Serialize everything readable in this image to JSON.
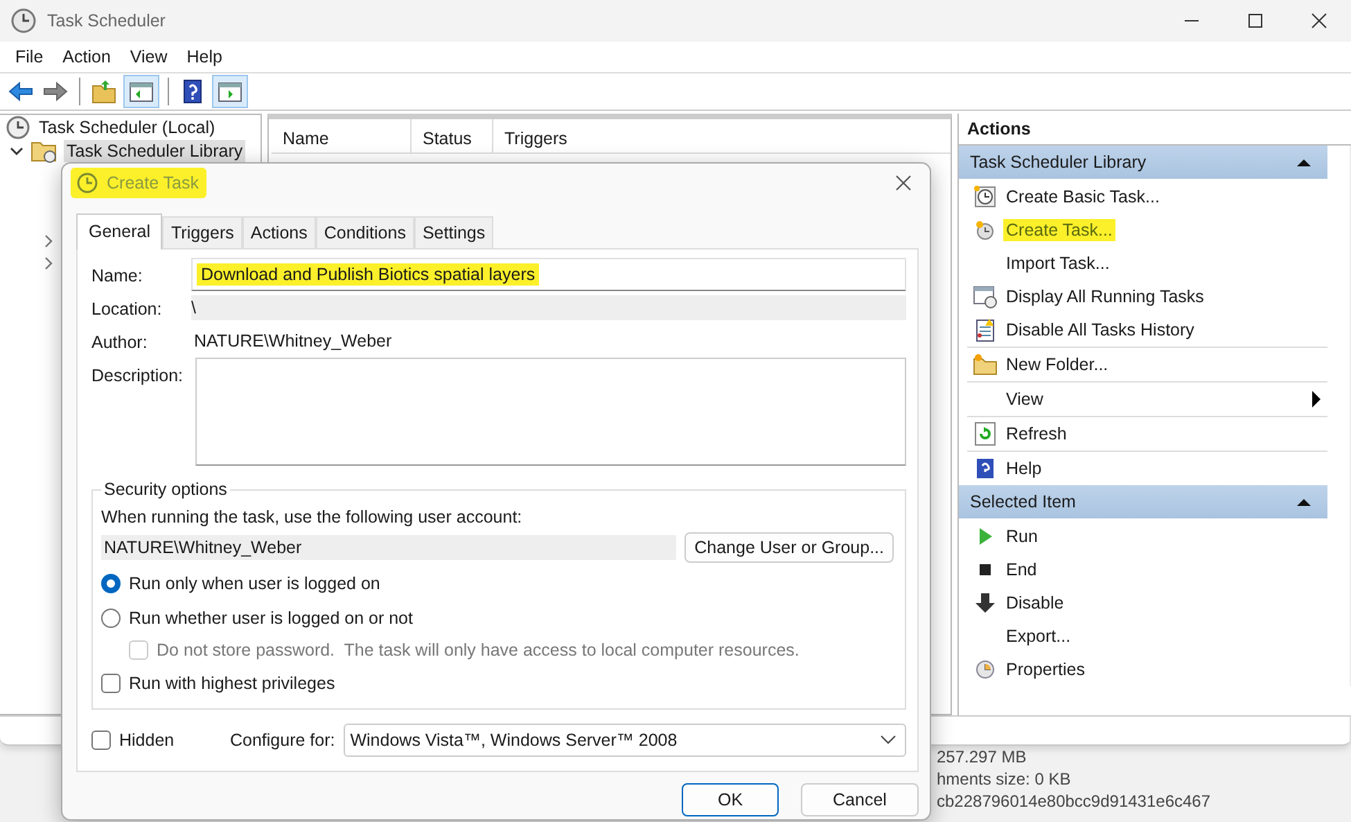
{
  "window": {
    "title": "Task Scheduler"
  },
  "menu": [
    "File",
    "Action",
    "View",
    "Help"
  ],
  "tree": [
    {
      "label": "Task Scheduler (Local)",
      "selected": false,
      "children": [
        {
          "label": "Task Scheduler Library",
          "selected": true,
          "expanded": true
        }
      ]
    }
  ],
  "table": {
    "columns": [
      "Name",
      "Status",
      "Triggers"
    ]
  },
  "actions": {
    "title": "Actions",
    "sections": [
      {
        "title": "Task Scheduler Library",
        "expanded": true,
        "items": [
          {
            "label": "Create Basic Task...",
            "kind": "basic",
            "highlighted": false,
            "divider": false
          },
          {
            "label": "Create Task...",
            "kind": "task",
            "highlighted": true,
            "divider": false
          },
          {
            "label": "Import Task...",
            "kind": "plain",
            "highlighted": false,
            "divider": false
          },
          {
            "label": "Display All Running Tasks",
            "kind": "running",
            "highlighted": false,
            "divider": false
          },
          {
            "label": "Disable All Tasks History",
            "kind": "history",
            "highlighted": false,
            "divider": false
          },
          {
            "label": "New Folder...",
            "kind": "folder",
            "highlighted": false,
            "divider": true
          },
          {
            "label": "View",
            "kind": "submenu",
            "highlighted": false,
            "divider": true
          },
          {
            "label": "Refresh",
            "kind": "refresh",
            "highlighted": false,
            "divider": true
          },
          {
            "label": "Help",
            "kind": "help",
            "highlighted": false,
            "divider": true
          }
        ]
      },
      {
        "title": "Selected Item",
        "expanded": true,
        "items": [
          {
            "label": "Run",
            "kind": "run",
            "highlighted": false,
            "divider": false
          },
          {
            "label": "End",
            "kind": "end",
            "highlighted": false,
            "divider": false
          },
          {
            "label": "Disable",
            "kind": "disable",
            "highlighted": false,
            "divider": false
          },
          {
            "label": "Export...",
            "kind": "plain",
            "highlighted": false,
            "divider": false
          },
          {
            "label": "Properties",
            "kind": "properties",
            "highlighted": false,
            "divider": false
          }
        ]
      }
    ]
  },
  "background_window": {
    "lines": [
      "257.297 MB",
      "hments size: 0 KB",
      "cb228796014e80bcc9d91431e6c467"
    ]
  },
  "dialog": {
    "title": "Create Task",
    "title_highlighted": true,
    "tabs": [
      {
        "label": "General",
        "selected": true
      },
      {
        "label": "Triggers",
        "selected": false
      },
      {
        "label": "Actions",
        "selected": false
      },
      {
        "label": "Conditions",
        "selected": false
      },
      {
        "label": "Settings",
        "selected": false
      }
    ],
    "name_label": "Name:",
    "name_value": "Download and Publish Biotics spatial layers",
    "name_highlighted": true,
    "location_label": "Location:",
    "location_value": "\\",
    "author_label": "Author:",
    "author_value": "NATURE\\Whitney_Weber",
    "description_label": "Description:",
    "security": {
      "title": "Security options",
      "prompt": "When running the task, use the following user account:",
      "account": "NATURE\\Whitney_Weber",
      "change_button": "Change User or Group...",
      "options": [
        {
          "label": "Run only when user is logged on",
          "selected": true
        },
        {
          "label": "Run whether user is logged on or not",
          "selected": false
        }
      ],
      "no_password": {
        "label": "Do not store password.  The task will only have access to local computer resources.",
        "checked": false,
        "disabled": true
      },
      "highest": {
        "label": "Run with highest privileges",
        "checked": false
      }
    },
    "hidden": {
      "label": "Hidden",
      "checked": false
    },
    "configure_label": "Configure for:",
    "configure_value": "Windows Vista™, Windows Server™ 2008",
    "buttons": [
      {
        "label": "OK",
        "default": true
      },
      {
        "label": "Cancel",
        "default": false
      }
    ]
  }
}
